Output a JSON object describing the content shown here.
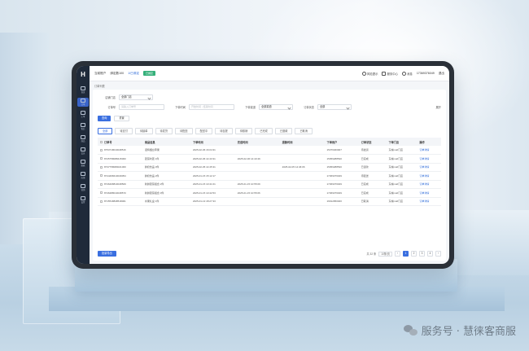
{
  "header": {
    "account_label": "当前账户",
    "account_value": "绑定数100",
    "link_label": "1/已绑定",
    "badge": "已绑定",
    "tools": [
      "风险提示",
      "服务中心",
      "消息"
    ],
    "user": "17369376049",
    "user_menu": "退出"
  },
  "breadcrumb": "订单列表",
  "sidebar": {
    "logo": "H",
    "items": [
      {
        "label": "首页",
        "active": false
      },
      {
        "label": "订单",
        "active": true
      },
      {
        "label": "工单",
        "active": false
      },
      {
        "label": "售后",
        "active": false
      },
      {
        "label": "商品",
        "active": false
      },
      {
        "label": "会员",
        "active": false
      },
      {
        "label": "数据",
        "active": false
      },
      {
        "label": "店铺",
        "active": false
      },
      {
        "label": "营销",
        "active": false
      },
      {
        "label": "设置",
        "active": false
      }
    ]
  },
  "filters": {
    "row1": {
      "label": "店铺门店",
      "value": "全部门店"
    },
    "row2": [
      {
        "label": "订单号",
        "placeholder": "请输入订单号"
      },
      {
        "label": "下单时间",
        "placeholder": "开始时间 - 结束时间"
      },
      {
        "label": "下单渠道",
        "value": "全部渠道"
      },
      {
        "label": "订单状态",
        "value": "全部"
      }
    ],
    "expand": "展开"
  },
  "buttons": {
    "search": "查询",
    "reset": "重置"
  },
  "tabs": [
    "全部",
    "待支付",
    "待接单",
    "待发货",
    "待配送",
    "配送中",
    "待自提",
    "待核销",
    "已完成",
    "已退款",
    "已取消"
  ],
  "table": {
    "columns": [
      "订单号",
      "商品信息",
      "下单时间",
      "完成时间",
      "退款时间",
      "下单用户",
      "订单状态",
      "下单门店",
      "操作"
    ],
    "rows": [
      [
        "8753718010048516",
        "诺特烟台苹果",
        "2025-02-06 16:04:31",
        "",
        "",
        "15376460007",
        "待发货",
        "东城mall门店",
        "订单详情"
      ],
      [
        "8725758088415060",
        "蔬菜时蔬 1件",
        "2025-02-06 14:43:31",
        "2025-02-06 14:43:49",
        "",
        "15056288530",
        "已完成",
        "东城mall门店",
        "订单详情"
      ],
      [
        "8737758080021060",
        "鲜奶饮品 3件",
        "2025-02-05 14:45:31",
        "",
        "2025-02-05 14:46:06",
        "15056288530",
        "已退款",
        "东城mall门店",
        "订单详情"
      ],
      [
        "8744468410049054",
        "鲜奶饮品 2件",
        "2025-01-15 15:12:17",
        "",
        "",
        "17369376049",
        "待配送",
        "东城mall门店",
        "订单详情"
      ],
      [
        "8746408810048509",
        "新鲜蔬菜组合 2件",
        "2025-01-15 10:41:01",
        "2025-01-15 10:55:09",
        "",
        "17369376049",
        "已完成",
        "东城mall门店",
        "订单详情"
      ],
      [
        "8746488010048570",
        "新鲜蔬菜组合 3件",
        "2025-01-15 10:42:53",
        "2025-01-15 10:55:06",
        "",
        "17369376049",
        "已完成",
        "东城mall门店",
        "订单详情"
      ],
      [
        "8715518848518001",
        "水果礼盒 1件",
        "2025-01-13 18:27:33",
        "",
        "",
        "19012950400",
        "已取消",
        "东城mall门店",
        "订单详情"
      ]
    ]
  },
  "footer": {
    "batch_button": "批量导出",
    "total": "共 32 条",
    "page_size": "10条/页",
    "pages": [
      "1",
      "2",
      "3",
      "4"
    ],
    "active_page": "1"
  },
  "watermark": "服务号 · 慧徕客商服",
  "colors": {
    "primary": "#3a6fe0",
    "sidebar": "#1f2a3a",
    "badge": "#35b07a",
    "link": "#2d6ad8"
  }
}
